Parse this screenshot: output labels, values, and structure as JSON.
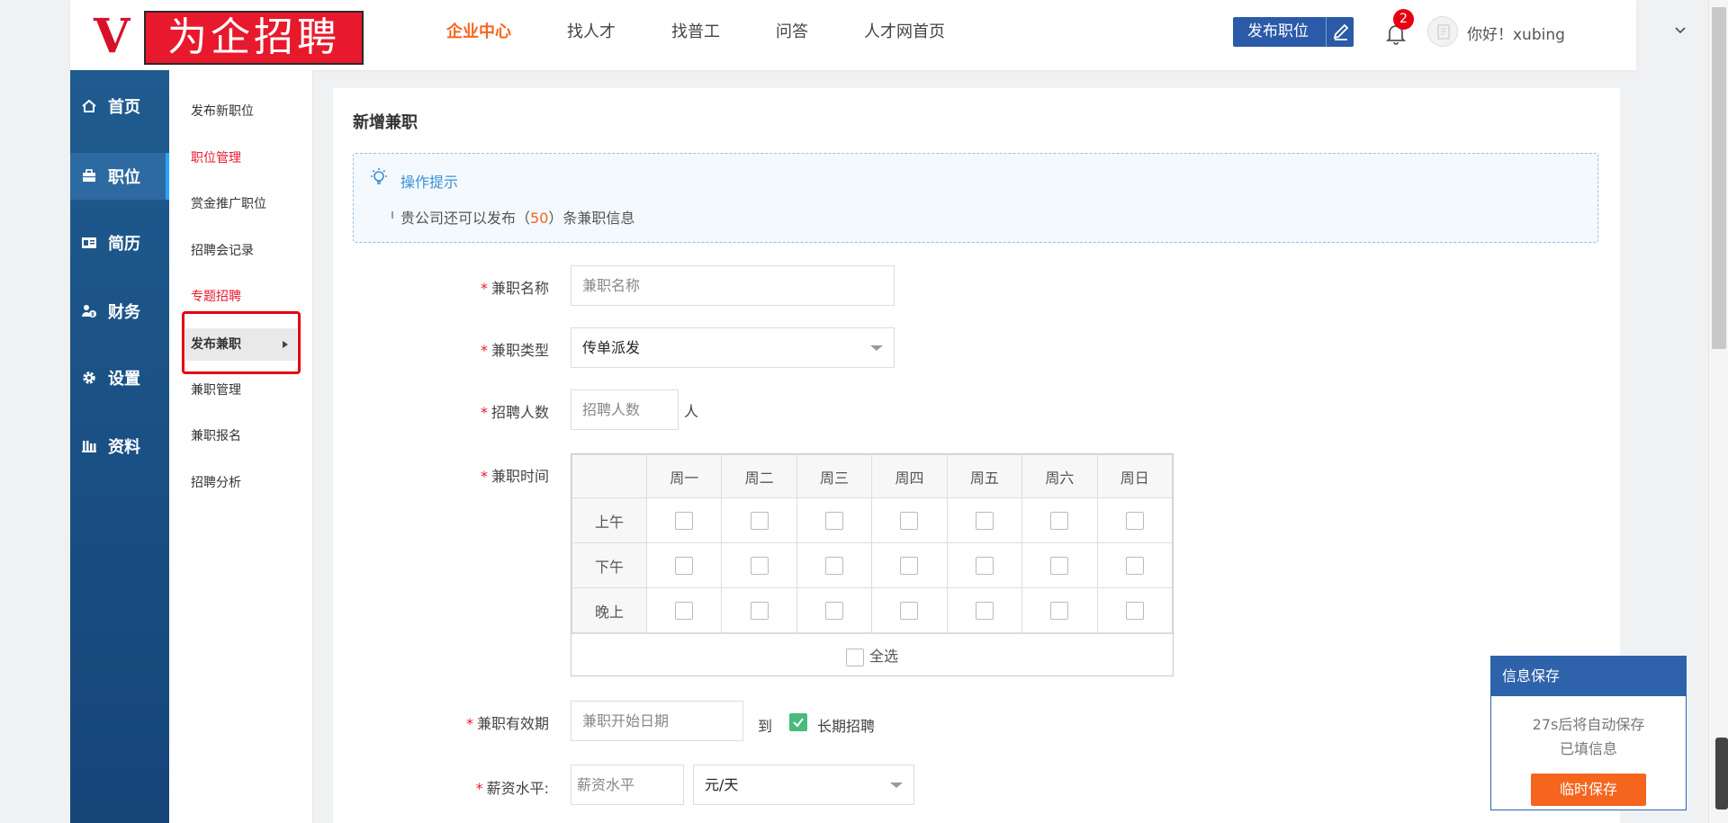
{
  "header": {
    "logo_v": "V",
    "logo_text": "为企招聘",
    "nav": [
      "企业中心",
      "找人才",
      "找普工",
      "问答",
      "人才网首页"
    ],
    "publish_label": "发布职位",
    "notification_count": "2",
    "greeting": "你好！xubing"
  },
  "sidebar": {
    "items": [
      {
        "label": "首页",
        "icon": "home-icon"
      },
      {
        "label": "职位",
        "icon": "briefcase-icon"
      },
      {
        "label": "简历",
        "icon": "id-card-icon"
      },
      {
        "label": "财务",
        "icon": "finance-icon"
      },
      {
        "label": "设置",
        "icon": "gear-icon"
      },
      {
        "label": "资料",
        "icon": "building-icon"
      }
    ]
  },
  "submenu": {
    "items": [
      "发布新职位",
      "职位管理",
      "赏金推广职位",
      "招聘会记录",
      "专题招聘",
      "发布兼职",
      "兼职管理",
      "兼职报名",
      "招聘分析"
    ]
  },
  "main": {
    "title": "新增兼职",
    "tip_title": "操作提示",
    "tip_prefix": "贵公司还可以发布（",
    "tip_num": "50",
    "tip_suffix": "）条兼职信息",
    "fields": {
      "name_label": "兼职名称",
      "name_placeholder": "兼职名称",
      "type_label": "兼职类型",
      "type_value": "传单派发",
      "count_label": "招聘人数",
      "count_placeholder": "招聘人数",
      "count_unit": "人",
      "time_label": "兼职时间",
      "valid_label": "兼职有效期",
      "valid_placeholder": "兼职开始日期",
      "to_label": "到",
      "long_term_label": "长期招聘",
      "salary_label": "薪资水平:",
      "salary_placeholder": "薪资水平",
      "salary_unit": "元/天"
    },
    "schedule": {
      "days": [
        "周一",
        "周二",
        "周三",
        "周四",
        "周五",
        "周六",
        "周日"
      ],
      "periods": [
        "上午",
        "下午",
        "晚上"
      ],
      "select_all": "全选"
    }
  },
  "save_widget": {
    "title": "信息保存",
    "line1": "27s后将自动保存",
    "line2": "已填信息",
    "button": "临时保存"
  },
  "colors": {
    "accent_orange": "#f6651e",
    "brand_blue": "#2b5aa8",
    "sidebar_blue": "#1f5b8e",
    "alert_red": "#e60012"
  }
}
